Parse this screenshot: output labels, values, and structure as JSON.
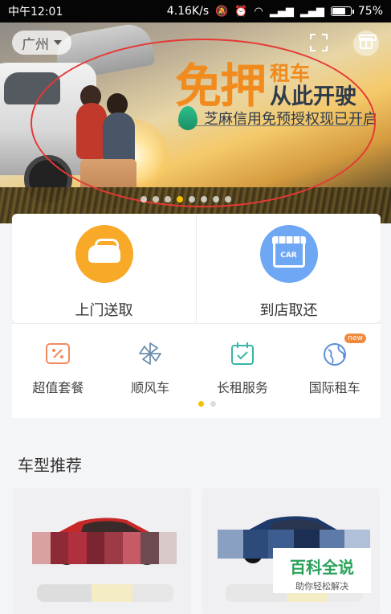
{
  "status_bar": {
    "time": "中午12:01",
    "speed": "4.16K/s",
    "battery": "75%",
    "battery_level": 0.75
  },
  "banner": {
    "headline_main": "免押",
    "headline_small_1": "租车",
    "headline_small_2": "从此开驶",
    "subline": "芝麻信用免预授权现已开启",
    "slide_count": 8,
    "active_slide": 4
  },
  "header": {
    "city": "广州"
  },
  "services": [
    {
      "label": "上门送取",
      "icon": "car-icon",
      "color": "#f7a927"
    },
    {
      "label": "到店取还",
      "icon": "store-icon",
      "color": "#6ea8f4",
      "icon_text": "CAR"
    }
  ],
  "quick_menu": {
    "items": [
      {
        "label": "超值套餐",
        "icon": "discount-icon"
      },
      {
        "label": "顺风车",
        "icon": "pinwheel-icon"
      },
      {
        "label": "长租服务",
        "icon": "calendar-icon"
      },
      {
        "label": "国际租车",
        "icon": "globe-icon",
        "badge": "new"
      }
    ],
    "page_count": 2,
    "active_page": 1
  },
  "recommend": {
    "title": "车型推荐"
  },
  "watermark": {
    "title": "百科全说",
    "subtitle": "助你轻松解决"
  },
  "colors": {
    "accent_yellow": "#f5c000",
    "headline_orange": "#f18b1e",
    "highlight_red": "#e53935"
  }
}
